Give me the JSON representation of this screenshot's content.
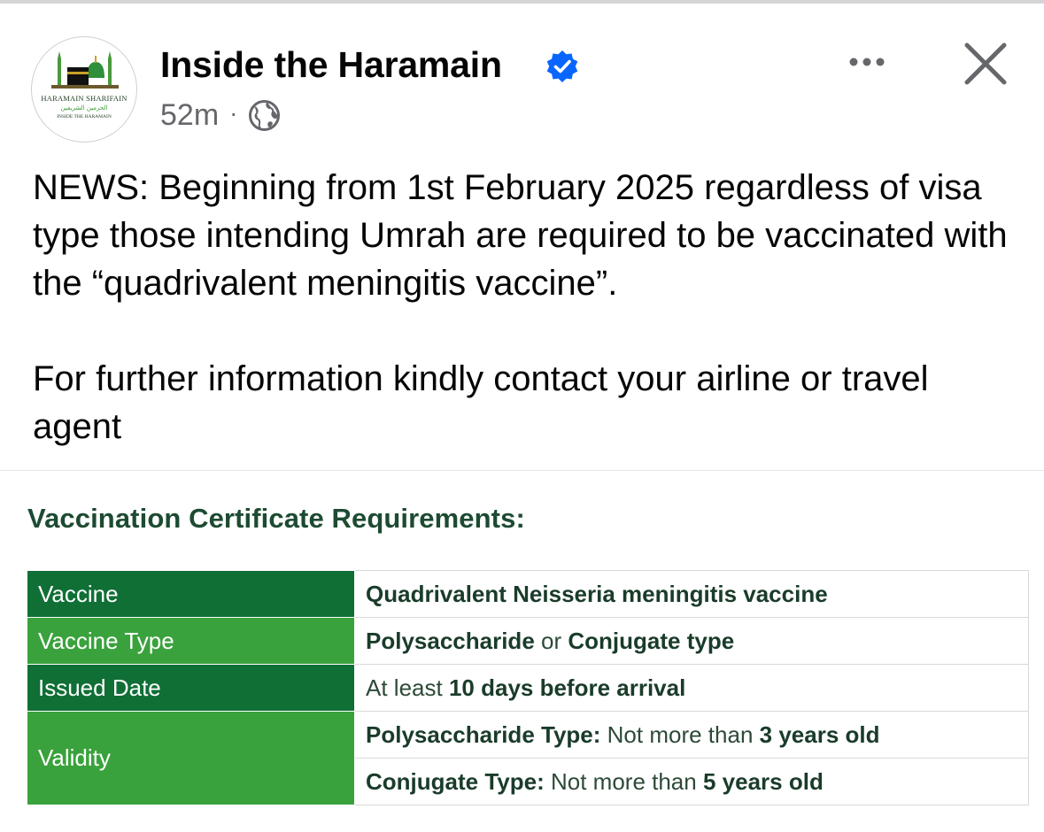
{
  "post": {
    "page_name": "Inside the Haramain",
    "timestamp": "52m",
    "separator": "·",
    "paragraphs": [
      "NEWS: Beginning from 1st February 2025 regardless of visa type those intending Umrah are required to be vaccinated with the “quadrivalent meningitis vaccine”.",
      "For further information kindly contact your airline or travel agent"
    ]
  },
  "avatar_logo": {
    "line1": "HARAMAIN SHARIFAIN",
    "line2": "الحرمين الشريفين",
    "line3": "INSIDE THE HARAMAIN"
  },
  "icons": {
    "verified": "verified-badge-icon",
    "audience": "globe-icon",
    "more": "more-options-icon",
    "close": "close-icon"
  },
  "colors": {
    "verified_blue": "#0866ff",
    "table_dark_green": "#0f6f35",
    "table_light_green": "#3aa23c",
    "title_green": "#1d4b32"
  },
  "image": {
    "title": "Vaccination Certificate Requirements:",
    "rows": [
      {
        "label": "Vaccine",
        "value_parts": [
          {
            "bold": "Quadrivalent Neisseria meningitis vaccine"
          }
        ]
      },
      {
        "label": "Vaccine Type",
        "value_parts": [
          {
            "bold": "Polysaccharide"
          },
          {
            "light": "or"
          },
          {
            "bold": "Conjugate type"
          }
        ]
      },
      {
        "label": "Issued Date",
        "value_parts": [
          {
            "light": "At least"
          },
          {
            "bold": "10 days before arrival"
          }
        ]
      },
      {
        "label": "Validity",
        "sub_rows": [
          [
            {
              "bold": "Polysaccharide Type:"
            },
            {
              "light": "Not more than"
            },
            {
              "bold": "3 years old"
            }
          ],
          [
            {
              "bold": "Conjugate Type:"
            },
            {
              "light": "Not more than"
            },
            {
              "bold": "5 years old"
            }
          ]
        ]
      }
    ]
  }
}
